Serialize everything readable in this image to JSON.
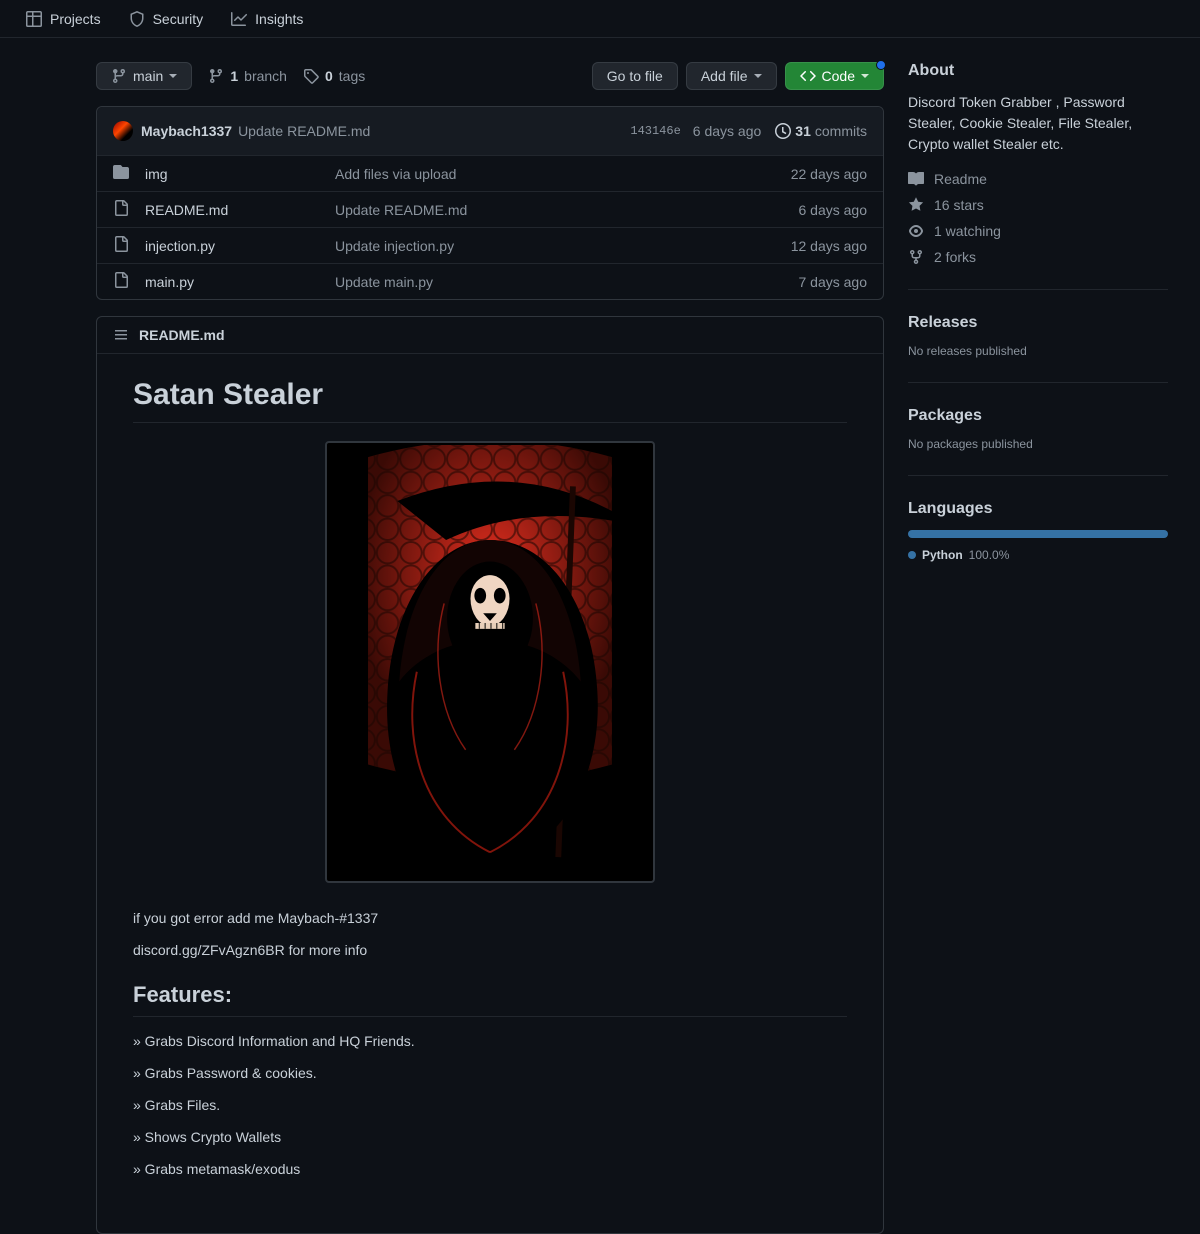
{
  "nav": [
    {
      "label": "Projects",
      "icon": "table"
    },
    {
      "label": "Security",
      "icon": "shield"
    },
    {
      "label": "Insights",
      "icon": "graph"
    }
  ],
  "branch_btn": "main",
  "branch_count": "1",
  "branch_word": "branch",
  "tag_count": "0",
  "tag_word": "tags",
  "go_to_file": "Go to file",
  "add_file": "Add file",
  "code_btn": "Code",
  "latest": {
    "author": "Maybach1337",
    "message": "Update README.md",
    "sha": "143146e",
    "time": "6 days ago",
    "commits_n": "31",
    "commits_w": "commits"
  },
  "files": [
    {
      "type": "dir",
      "name": "img",
      "msg": "Add files via upload",
      "age": "22 days ago"
    },
    {
      "type": "file",
      "name": "README.md",
      "msg": "Update README.md",
      "age": "6 days ago"
    },
    {
      "type": "file",
      "name": "injection.py",
      "msg": "Update injection.py",
      "age": "12 days ago"
    },
    {
      "type": "file",
      "name": "main.py",
      "msg": "Update main.py",
      "age": "7 days ago"
    }
  ],
  "readme_filename": "README.md",
  "readme": {
    "title": "Satan Stealer",
    "p1": "if you got error add me Maybach-#1337",
    "p2": "discord.gg/ZFvAgzn6BR for more info",
    "features_h": "Features:",
    "features": [
      "» Grabs Discord Information and HQ Friends.",
      "» Grabs Password & cookies.",
      "» Grabs Files.",
      "» Shows Crypto Wallets",
      "» Grabs metamask/exodus"
    ]
  },
  "about": {
    "title": "About",
    "desc": "Discord Token Grabber , Password Stealer, Cookie Stealer, File Stealer, Crypto wallet Stealer etc.",
    "readme": "Readme",
    "stars": "16 stars",
    "watching": "1 watching",
    "forks": "2 forks"
  },
  "releases": {
    "title": "Releases",
    "empty": "No releases published"
  },
  "packages": {
    "title": "Packages",
    "empty": "No packages published"
  },
  "languages": {
    "title": "Languages",
    "lang": "Python",
    "pct": "100.0%"
  }
}
